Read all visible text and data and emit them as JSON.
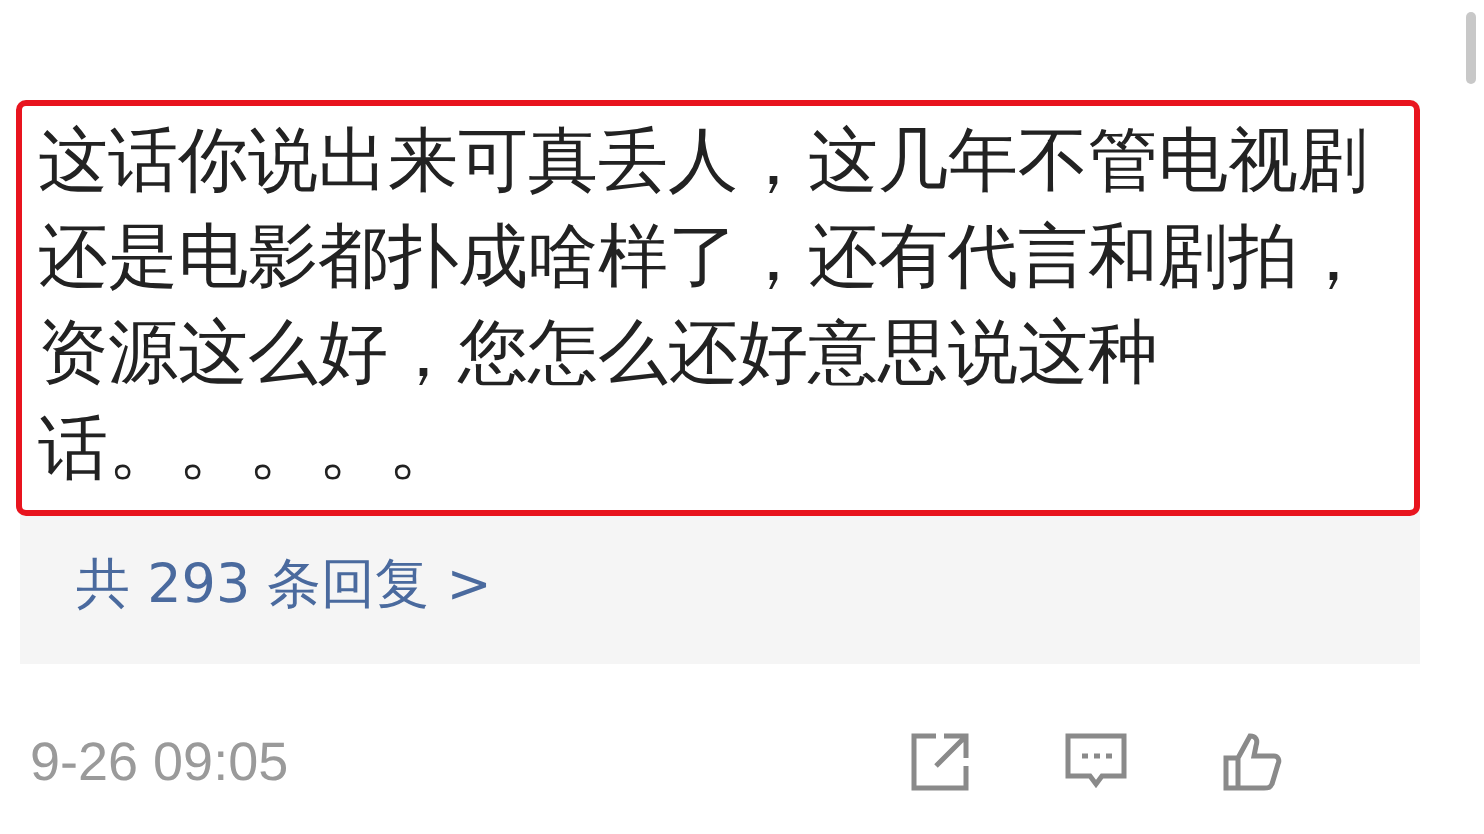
{
  "comment": {
    "lines": [
      "这话你说出来可真丢人，这几年不管电视剧",
      "还是电影都扑成啥样了，还有代言和剧拍，",
      "资源这么好，您怎么还好意思说这种",
      "话。。。。。"
    ]
  },
  "replies": {
    "label": "共 293 条回复 >"
  },
  "footer": {
    "time": "9-26 09:05"
  }
}
